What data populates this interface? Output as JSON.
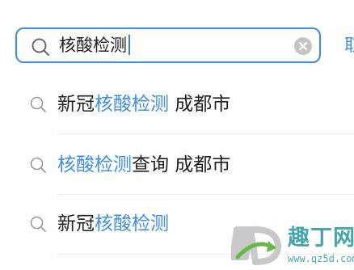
{
  "search": {
    "value": "核酸检测",
    "cancel_label": "取消"
  },
  "suggestions": [
    {
      "parts": [
        "新冠",
        "核酸检测",
        " 成都市"
      ]
    },
    {
      "parts": [
        "",
        "核酸检测",
        "查询 成都市"
      ]
    },
    {
      "parts": [
        "新冠",
        "核酸检测",
        ""
      ]
    }
  ],
  "watermark": {
    "name": "趣丁网",
    "url": "www.qz5d.com"
  },
  "colors": {
    "accent": "#3b8ce8",
    "highlight": "#3f8ee0",
    "watermark": "#47a6ad"
  },
  "icons": {
    "search": "search-icon",
    "clear": "clear-icon",
    "suggestion": "search-icon"
  }
}
